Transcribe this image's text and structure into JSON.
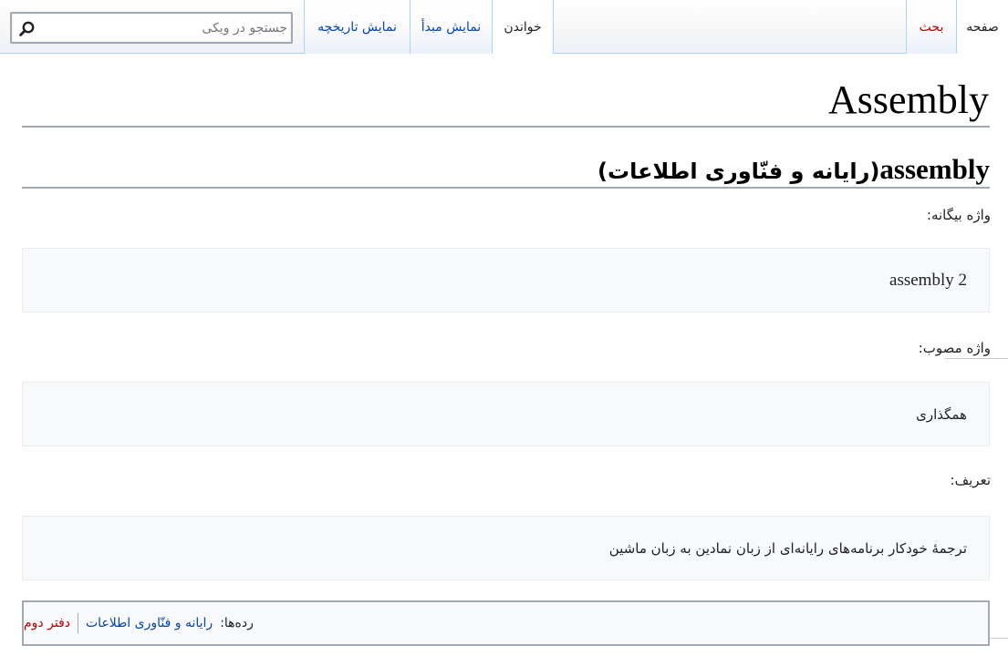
{
  "tabs": {
    "page": "صفحه",
    "talk": "بحث",
    "read": "خواندن",
    "view_source": "نمایش مبدأ",
    "view_history": "نمایش تاریخچه"
  },
  "search": {
    "placeholder": "جستجو در ویکی",
    "icon": "search-icon"
  },
  "article": {
    "title": "Assembly",
    "section_heading_en": "assembly",
    "section_heading_fa": "(رایانه و فنّاوری اطلاعات)",
    "foreign_word_label": "واژه بیگانه:",
    "foreign_word_value": "assembly 2",
    "approved_word_label": "واژه مصوب:",
    "approved_word_value": "همگذاری",
    "definition_label": "تعریف:",
    "definition_value": "ترجمۀ خودکار برنامه‌های رایانه‌ای از زبان نمادین به زبان ماشین"
  },
  "categories": {
    "label": "رده‌ها:",
    "items": [
      "رایانه و فنّاوری اطلاعات",
      "دفتر دوم"
    ]
  },
  "colors": {
    "link": "#0645ad",
    "missing_link": "#ba0000",
    "tab_border": "#a7d7f9",
    "box_background": "#f8f9fa"
  }
}
